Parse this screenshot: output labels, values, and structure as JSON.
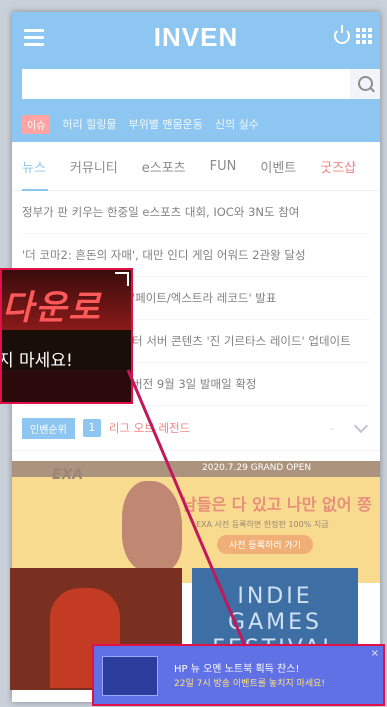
{
  "header": {
    "logo": "INVEN"
  },
  "search": {
    "placeholder": ""
  },
  "hot": {
    "badge": "이슈",
    "items": [
      "허리 힐링물",
      "부위별 맨몸운동",
      "신의 실수"
    ]
  },
  "nav": {
    "tabs": [
      "뉴스",
      "커뮤니티",
      "e스포츠",
      "FUN",
      "이벤트",
      "굿즈샵"
    ]
  },
  "news": [
    "정부가 판 키우는 한중일 e스포츠 대회, IOC와 3N도 참여",
    "'더 코마2: 흔돈의 자매', 대만 인디 게임 어워드 2관왕 달성",
    "'페이트/엑스트라 레코드' 발표",
    "터 서버 콘텐츠 '진 기르타스 레이드' 업데이트",
    "버전 9월 3일 발매일 확정"
  ],
  "ranking": {
    "badge": "인벤순위",
    "num": "1",
    "name": "리그 오브 레전드",
    "dash": "-"
  },
  "banner": {
    "exa": "EXA",
    "date": "2020.7.29 GRAND OPEN",
    "title": "남들은 다 있고 나만 없어 쫑",
    "sub": "EXA 사전 등록하면 한정판 100% 지급",
    "button": "사전 등록하러 가기"
  },
  "thumbs": {
    "right_text": "INDIE GAMES FESTIVAL"
  },
  "popup": {
    "title": "HP 뉴 오멘 노트북 획득 찬스!",
    "desc": "22일 7시 방송 이벤트를 놓치지 마세요!",
    "close": "×"
  },
  "magnifier": {
    "big_text": "다운로",
    "text": "지 마세요!"
  }
}
